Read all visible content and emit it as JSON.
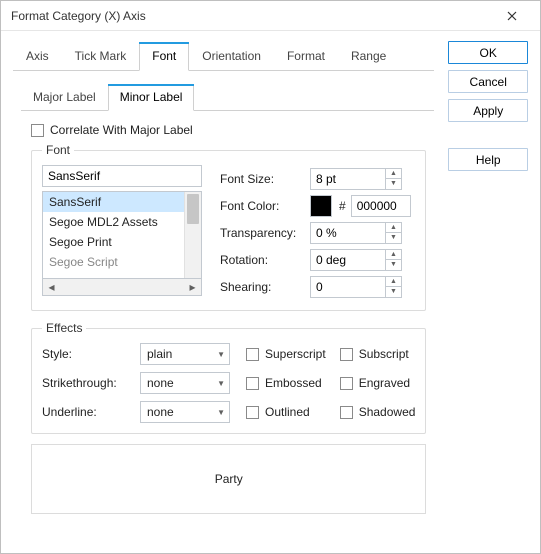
{
  "window": {
    "title": "Format Category (X) Axis"
  },
  "tabs": {
    "items": [
      "Axis",
      "Tick Mark",
      "Font",
      "Orientation",
      "Format",
      "Range"
    ],
    "active": 2
  },
  "subtabs": {
    "items": [
      "Major Label",
      "Minor Label"
    ],
    "active": 1
  },
  "correlate": {
    "label": "Correlate With Major Label",
    "checked": false
  },
  "font": {
    "legend": "Font",
    "value": "SansSerif",
    "list": [
      "SansSerif",
      "Segoe MDL2 Assets",
      "Segoe Print",
      "Segoe Script"
    ],
    "selectedIndex": 0
  },
  "props": {
    "fontSize": {
      "label": "Font Size:",
      "value": "8 pt"
    },
    "fontColor": {
      "label": "Font Color:",
      "hex": "000000",
      "swatch": "#000000"
    },
    "transparency": {
      "label": "Transparency:",
      "value": "0 %"
    },
    "rotation": {
      "label": "Rotation:",
      "value": "0 deg"
    },
    "shearing": {
      "label": "Shearing:",
      "value": "0"
    }
  },
  "effects": {
    "legend": "Effects",
    "style": {
      "label": "Style:",
      "value": "plain"
    },
    "strikethrough": {
      "label": "Strikethrough:",
      "value": "none"
    },
    "underline": {
      "label": "Underline:",
      "value": "none"
    },
    "checks": {
      "superscript": {
        "label": "Superscript",
        "checked": false
      },
      "embossed": {
        "label": "Embossed",
        "checked": false
      },
      "outlined": {
        "label": "Outlined",
        "checked": false
      },
      "subscript": {
        "label": "Subscript",
        "checked": false
      },
      "engraved": {
        "label": "Engraved",
        "checked": false
      },
      "shadowed": {
        "label": "Shadowed",
        "checked": false
      }
    }
  },
  "preview": {
    "text": "Party"
  },
  "buttons": {
    "ok": "OK",
    "cancel": "Cancel",
    "apply": "Apply",
    "help": "Help"
  },
  "hash": "#"
}
